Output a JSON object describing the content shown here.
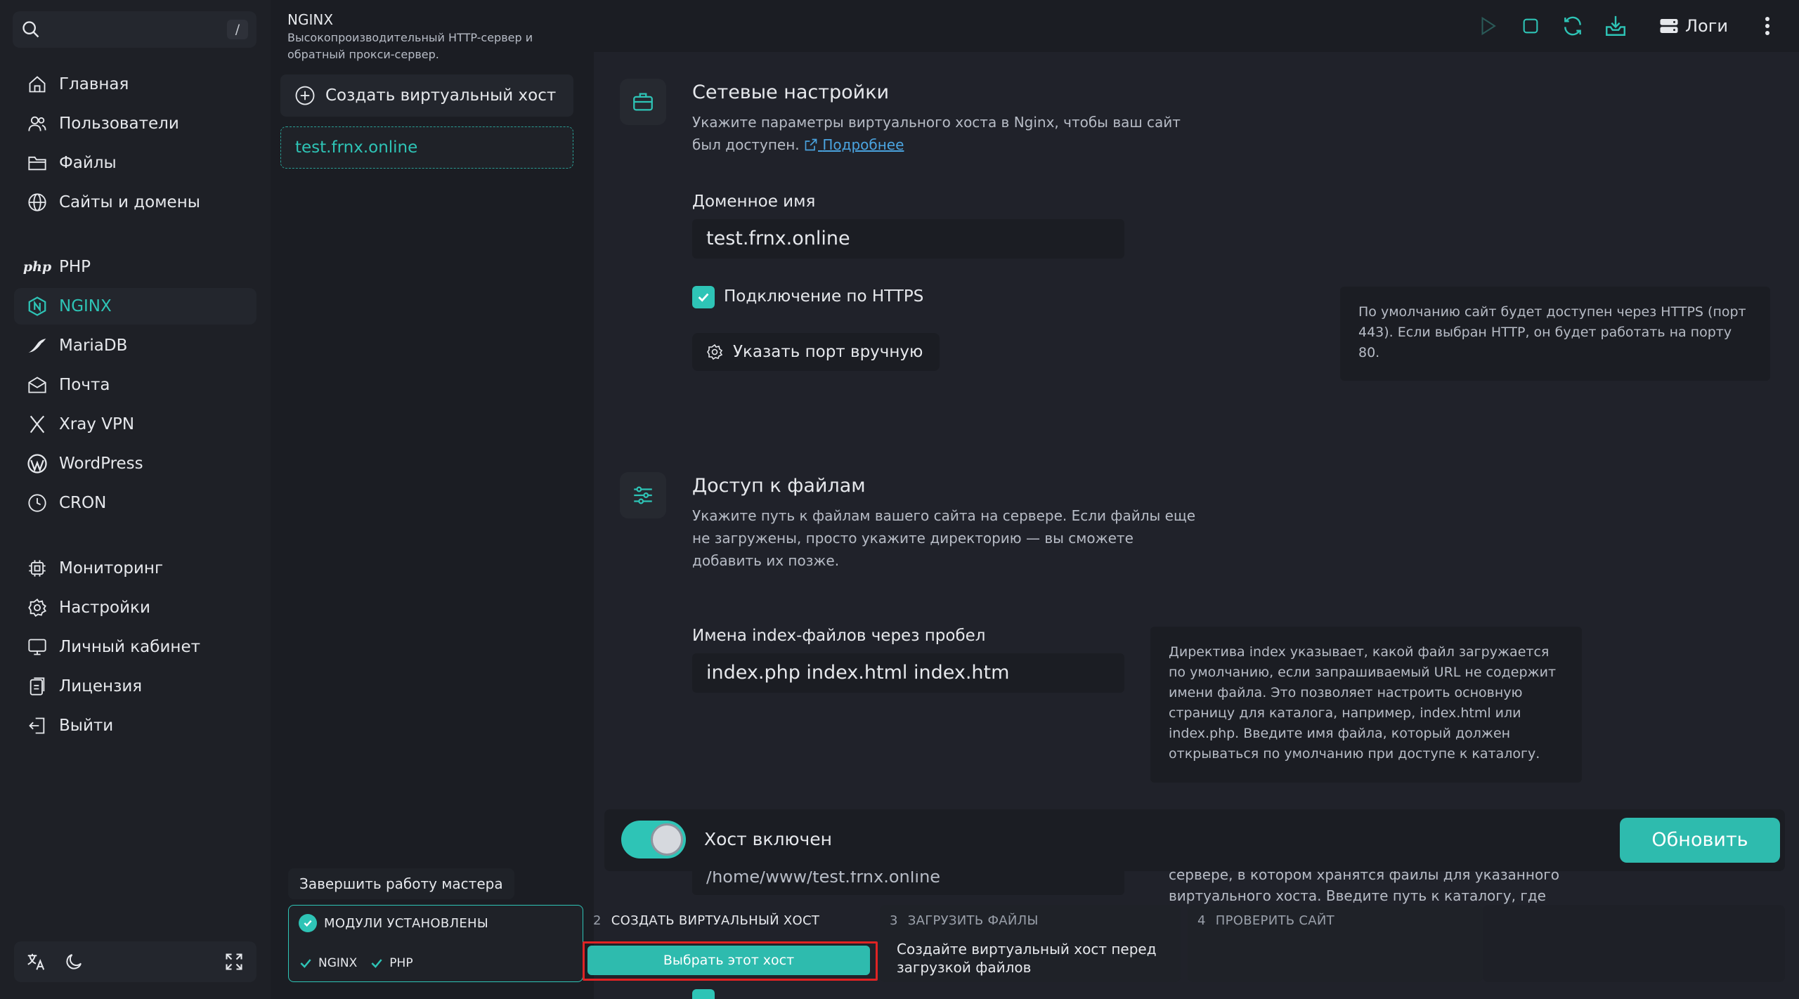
{
  "search": {
    "shortcut": "/"
  },
  "sidebar": {
    "items": [
      {
        "label": "Главная",
        "icon": "home-icon"
      },
      {
        "label": "Пользователи",
        "icon": "users-icon"
      },
      {
        "label": "Файлы",
        "icon": "folder-icon"
      },
      {
        "label": "Сайты и домены",
        "icon": "globe-icon"
      },
      {
        "label": "PHP",
        "icon": "php-icon",
        "logo_text": "php"
      },
      {
        "label": "NGINX",
        "icon": "nginx-icon",
        "active": true
      },
      {
        "label": "MariaDB",
        "icon": "mariadb-icon"
      },
      {
        "label": "Почта",
        "icon": "mail-icon"
      },
      {
        "label": "Xray VPN",
        "icon": "xray-icon"
      },
      {
        "label": "WordPress",
        "icon": "wordpress-icon"
      },
      {
        "label": "CRON",
        "icon": "clock-icon"
      },
      {
        "label": "Мониторинг",
        "icon": "cpu-icon"
      },
      {
        "label": "Настройки",
        "icon": "gear-icon"
      },
      {
        "label": "Личный кабинет",
        "icon": "monitor-icon"
      },
      {
        "label": "Лицензия",
        "icon": "license-icon"
      },
      {
        "label": "Выйти",
        "icon": "logout-icon"
      }
    ]
  },
  "hostpanel": {
    "title": "NGINX",
    "subtitle": "Высокопроизводительный HTTP-сервер и обратный прокси-сервер.",
    "create_label": "Создать виртуальный хост",
    "hosts": [
      "test.frnx.online"
    ]
  },
  "topbar": {
    "logs_label": "Логи"
  },
  "network": {
    "title": "Сетевые настройки",
    "desc": "Укажите параметры виртуального хоста в Nginx, чтобы ваш сайт был доступен.",
    "link": "Подробнее",
    "domain_label": "Доменное имя",
    "domain_value": "test.frnx.online",
    "https_label": "Подключение по HTTPS",
    "https_checked": true,
    "port_button": "Указать порт вручную",
    "https_hint": "По умолчанию сайт будет доступен через HTTPS (порт 443). Если выбран HTTP, он будет работать на порту 80."
  },
  "files": {
    "title": "Доступ к файлам",
    "desc": "Укажите путь к файлам вашего сайта на сервере. Если файлы еще не загружены, просто укажите директорию — вы сможете добавить их позже.",
    "index_label": "Имена index-файлов через пробел",
    "index_value": "index.php index.html index.htm",
    "index_hint": "Директива index указывает, какой файл загружается по умолчанию, если запрашиваемый URL не содержит имени файла. Это позволяет настроить основную страницу для каталога, например, index.html или index.php. Введите имя файла, который должен открываться по умолчанию при доступе к каталогу.",
    "root_value_peek": "/home/www/test.frnx.online",
    "root_hint_peek": "сервере, в котором хранятся файлы для указанного виртуального хоста. Введите путь к каталогу, где"
  },
  "hostbar": {
    "enabled_label": "Хост включен",
    "enabled": true,
    "update_label": "Обновить"
  },
  "wizard": {
    "finish_label": "Завершить работу мастера",
    "step1": {
      "title": "МОДУЛИ УСТАНОВЛЕНЫ",
      "modules": [
        "NGINX",
        "PHP"
      ]
    },
    "step2": {
      "num": "2",
      "title": "СОЗДАТЬ ВИРТУАЛЬНЫЙ ХОСТ",
      "button": "Выбрать этот хост"
    },
    "step3": {
      "num": "3",
      "title": "ЗАГРУЗИТЬ ФАЙЛЫ",
      "text": "Создайте виртуальный хост перед загрузкой файлов"
    },
    "step4": {
      "num": "4",
      "title": "ПРОВЕРИТЬ САЙТ"
    }
  },
  "colors": {
    "accent": "#2ec4b6",
    "highlight": "#e02424",
    "background": "#20222a"
  }
}
